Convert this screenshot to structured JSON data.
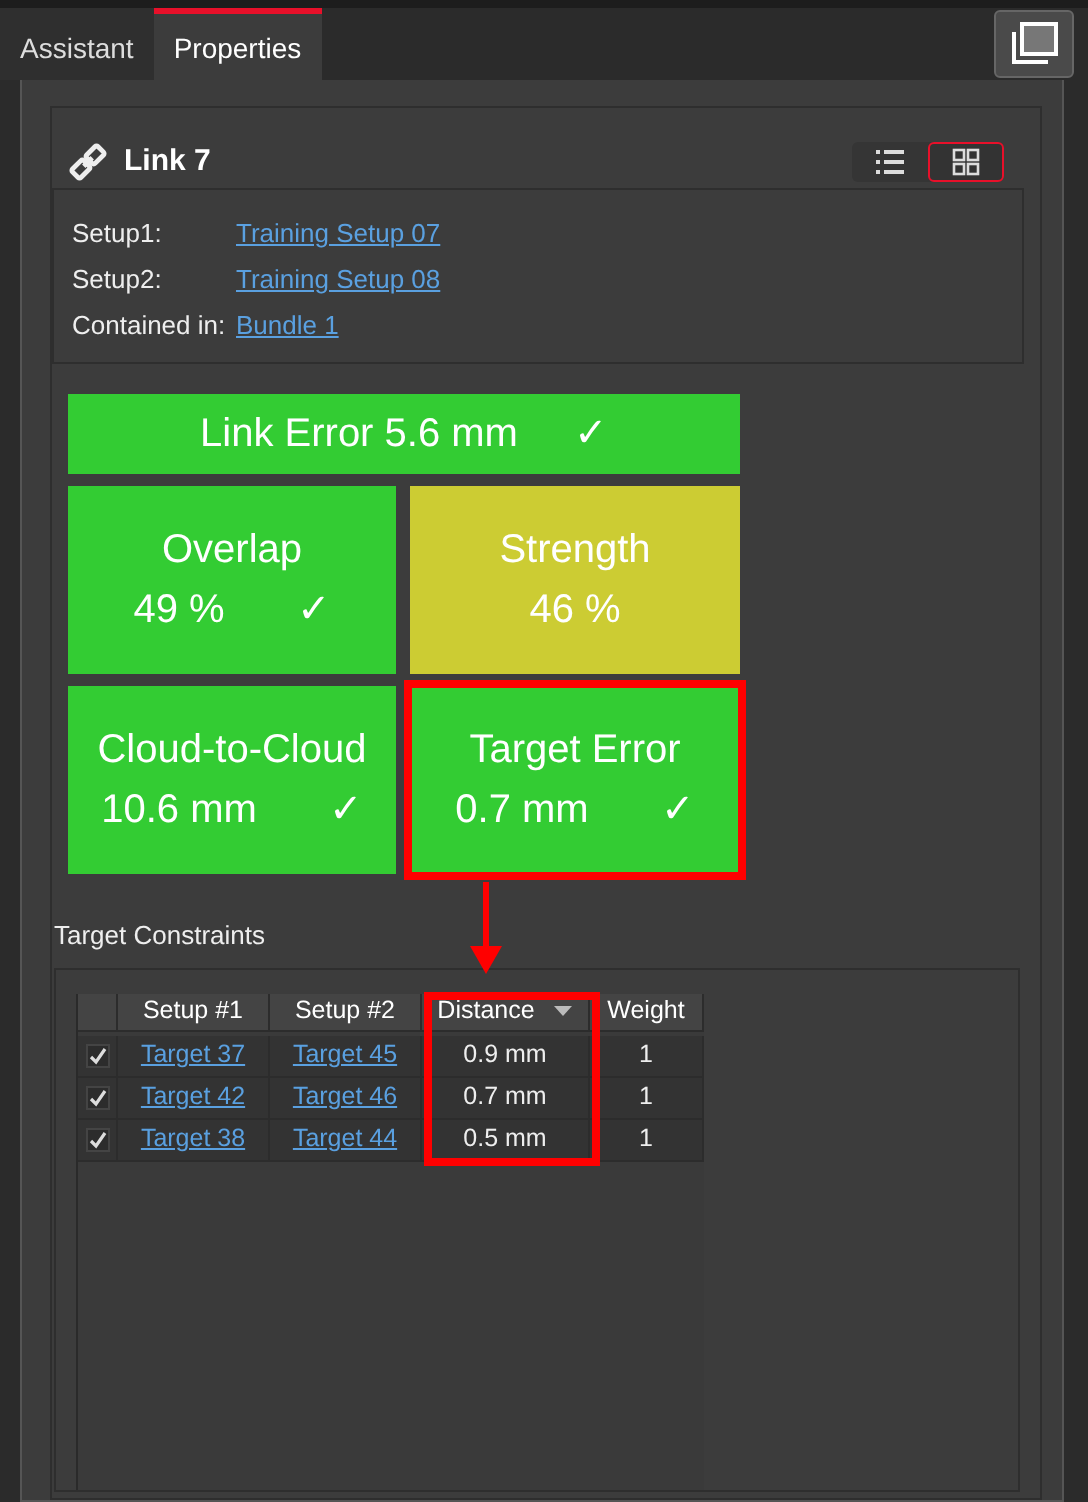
{
  "tabs": [
    {
      "label": "Assistant",
      "selected": false
    },
    {
      "label": "Properties",
      "selected": true
    }
  ],
  "header": {
    "title": "Link 7",
    "views": [
      {
        "kind": "list",
        "selected": false
      },
      {
        "kind": "grid",
        "selected": true
      }
    ]
  },
  "info": [
    {
      "label": "Setup1:",
      "value": "Training Setup 07"
    },
    {
      "label": "Setup2:",
      "value": "Training Setup 08"
    },
    {
      "label": "Contained in:",
      "value": "Bundle 1"
    }
  ],
  "tiles": [
    {
      "kind": "wide",
      "label": "Link Error 5.6 mm",
      "check": "✓",
      "color": "#33cc33",
      "highlighted": false
    },
    {
      "kind": "tile",
      "label": "Overlap",
      "value": "49 %",
      "check": "✓",
      "color": "#33cc33",
      "highlighted": false
    },
    {
      "kind": "tile",
      "label": "Strength",
      "value": "46 %",
      "color": "#cccc33",
      "highlighted": false
    },
    {
      "kind": "tile",
      "label": "Cloud-to-Cloud",
      "value": "10.6 mm",
      "check": "✓",
      "color": "#33cc33",
      "highlighted": false
    },
    {
      "kind": "tile",
      "label": "Target Error",
      "value": "0.7 mm",
      "check": "✓",
      "color": "#33cc33",
      "highlighted": true
    }
  ],
  "table": {
    "title": "Target Constraints",
    "columns": [
      {
        "label": "Setup #1",
        "sorted": false,
        "highlighted": false
      },
      {
        "label": "Setup #2",
        "sorted": false,
        "highlighted": false
      },
      {
        "label": "Distance",
        "sorted": true,
        "highlighted": true
      },
      {
        "label": "Weight",
        "sorted": false,
        "highlighted": false
      }
    ],
    "rows": [
      {
        "checked": true,
        "cells": [
          "Target 37",
          "Target 45",
          "0.9 mm",
          "1"
        ]
      },
      {
        "checked": true,
        "cells": [
          "Target 42",
          "Target 46",
          "0.7 mm",
          "1"
        ]
      },
      {
        "checked": true,
        "cells": [
          "Target 38",
          "Target 44",
          "0.5 mm",
          "1"
        ]
      }
    ]
  }
}
